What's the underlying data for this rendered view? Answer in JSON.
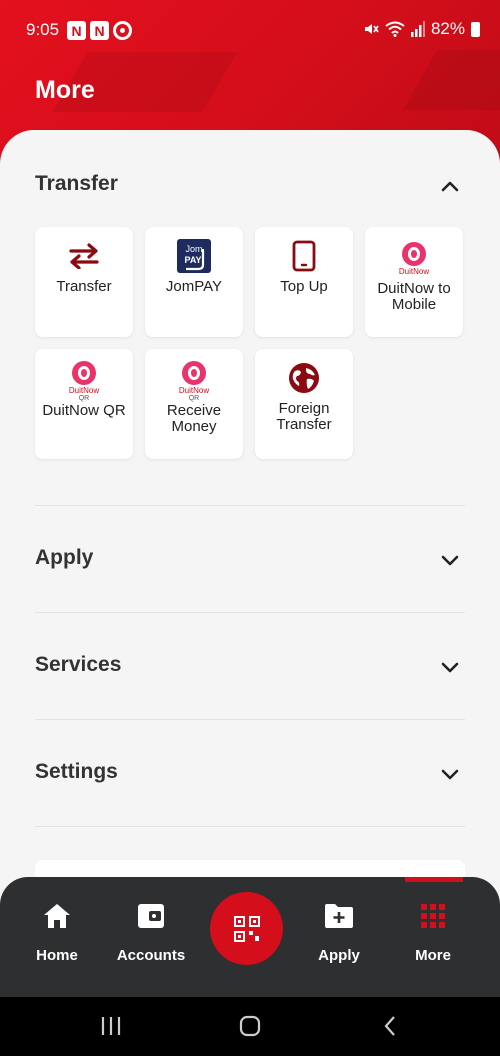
{
  "status": {
    "time": "9:05",
    "battery": "82%",
    "left_icons": [
      "N",
      "N"
    ]
  },
  "header": {
    "title": "More"
  },
  "sections": {
    "transfer": {
      "title": "Transfer",
      "items": [
        {
          "label": "Transfer",
          "icon": "transfer-arrows-icon"
        },
        {
          "label": "JomPAY",
          "icon": "jompay-logo-icon",
          "logo_text_top": "Jom",
          "logo_text_bottom": "PAY"
        },
        {
          "label": "Top Up",
          "icon": "phone-icon"
        },
        {
          "label": "DuitNow to Mobile",
          "icon": "duitnow-icon",
          "logo_text": "DuitNow"
        },
        {
          "label": "DuitNow QR",
          "icon": "duitnow-qr-icon",
          "logo_text": "DuitNow",
          "logo_sub": "QR"
        },
        {
          "label": "Receive Money",
          "icon": "duitnow-qr-icon",
          "logo_text": "DuitNow",
          "logo_sub": "QR"
        },
        {
          "label": "Foreign Transfer",
          "icon": "globe-icon"
        }
      ]
    },
    "apply": {
      "title": "Apply"
    },
    "services": {
      "title": "Services"
    },
    "settings": {
      "title": "Settings"
    }
  },
  "bottom_nav": {
    "home": "Home",
    "accounts": "Accounts",
    "apply": "Apply",
    "more": "More"
  },
  "colors": {
    "brand_red": "#d40e1a",
    "nav_bg": "#2e2f31",
    "duitnow_pink": "#e8336b"
  }
}
